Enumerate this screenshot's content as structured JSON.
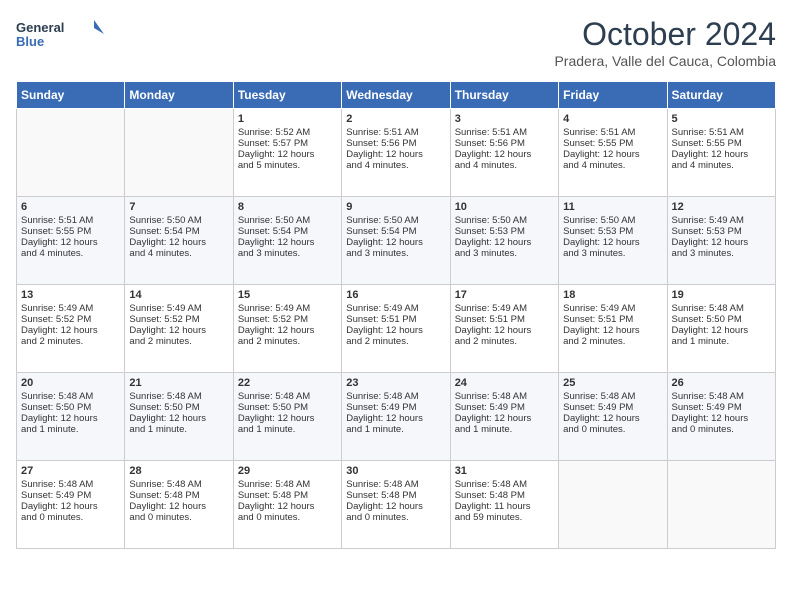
{
  "header": {
    "logo_line1": "General",
    "logo_line2": "Blue",
    "title": "October 2024",
    "subtitle": "Pradera, Valle del Cauca, Colombia"
  },
  "weekdays": [
    "Sunday",
    "Monday",
    "Tuesday",
    "Wednesday",
    "Thursday",
    "Friday",
    "Saturday"
  ],
  "weeks": [
    [
      {
        "day": "",
        "content": ""
      },
      {
        "day": "",
        "content": ""
      },
      {
        "day": "1",
        "content": "Sunrise: 5:52 AM\nSunset: 5:57 PM\nDaylight: 12 hours\nand 5 minutes."
      },
      {
        "day": "2",
        "content": "Sunrise: 5:51 AM\nSunset: 5:56 PM\nDaylight: 12 hours\nand 4 minutes."
      },
      {
        "day": "3",
        "content": "Sunrise: 5:51 AM\nSunset: 5:56 PM\nDaylight: 12 hours\nand 4 minutes."
      },
      {
        "day": "4",
        "content": "Sunrise: 5:51 AM\nSunset: 5:55 PM\nDaylight: 12 hours\nand 4 minutes."
      },
      {
        "day": "5",
        "content": "Sunrise: 5:51 AM\nSunset: 5:55 PM\nDaylight: 12 hours\nand 4 minutes."
      }
    ],
    [
      {
        "day": "6",
        "content": "Sunrise: 5:51 AM\nSunset: 5:55 PM\nDaylight: 12 hours\nand 4 minutes."
      },
      {
        "day": "7",
        "content": "Sunrise: 5:50 AM\nSunset: 5:54 PM\nDaylight: 12 hours\nand 4 minutes."
      },
      {
        "day": "8",
        "content": "Sunrise: 5:50 AM\nSunset: 5:54 PM\nDaylight: 12 hours\nand 3 minutes."
      },
      {
        "day": "9",
        "content": "Sunrise: 5:50 AM\nSunset: 5:54 PM\nDaylight: 12 hours\nand 3 minutes."
      },
      {
        "day": "10",
        "content": "Sunrise: 5:50 AM\nSunset: 5:53 PM\nDaylight: 12 hours\nand 3 minutes."
      },
      {
        "day": "11",
        "content": "Sunrise: 5:50 AM\nSunset: 5:53 PM\nDaylight: 12 hours\nand 3 minutes."
      },
      {
        "day": "12",
        "content": "Sunrise: 5:49 AM\nSunset: 5:53 PM\nDaylight: 12 hours\nand 3 minutes."
      }
    ],
    [
      {
        "day": "13",
        "content": "Sunrise: 5:49 AM\nSunset: 5:52 PM\nDaylight: 12 hours\nand 2 minutes."
      },
      {
        "day": "14",
        "content": "Sunrise: 5:49 AM\nSunset: 5:52 PM\nDaylight: 12 hours\nand 2 minutes."
      },
      {
        "day": "15",
        "content": "Sunrise: 5:49 AM\nSunset: 5:52 PM\nDaylight: 12 hours\nand 2 minutes."
      },
      {
        "day": "16",
        "content": "Sunrise: 5:49 AM\nSunset: 5:51 PM\nDaylight: 12 hours\nand 2 minutes."
      },
      {
        "day": "17",
        "content": "Sunrise: 5:49 AM\nSunset: 5:51 PM\nDaylight: 12 hours\nand 2 minutes."
      },
      {
        "day": "18",
        "content": "Sunrise: 5:49 AM\nSunset: 5:51 PM\nDaylight: 12 hours\nand 2 minutes."
      },
      {
        "day": "19",
        "content": "Sunrise: 5:48 AM\nSunset: 5:50 PM\nDaylight: 12 hours\nand 1 minute."
      }
    ],
    [
      {
        "day": "20",
        "content": "Sunrise: 5:48 AM\nSunset: 5:50 PM\nDaylight: 12 hours\nand 1 minute."
      },
      {
        "day": "21",
        "content": "Sunrise: 5:48 AM\nSunset: 5:50 PM\nDaylight: 12 hours\nand 1 minute."
      },
      {
        "day": "22",
        "content": "Sunrise: 5:48 AM\nSunset: 5:50 PM\nDaylight: 12 hours\nand 1 minute."
      },
      {
        "day": "23",
        "content": "Sunrise: 5:48 AM\nSunset: 5:49 PM\nDaylight: 12 hours\nand 1 minute."
      },
      {
        "day": "24",
        "content": "Sunrise: 5:48 AM\nSunset: 5:49 PM\nDaylight: 12 hours\nand 1 minute."
      },
      {
        "day": "25",
        "content": "Sunrise: 5:48 AM\nSunset: 5:49 PM\nDaylight: 12 hours\nand 0 minutes."
      },
      {
        "day": "26",
        "content": "Sunrise: 5:48 AM\nSunset: 5:49 PM\nDaylight: 12 hours\nand 0 minutes."
      }
    ],
    [
      {
        "day": "27",
        "content": "Sunrise: 5:48 AM\nSunset: 5:49 PM\nDaylight: 12 hours\nand 0 minutes."
      },
      {
        "day": "28",
        "content": "Sunrise: 5:48 AM\nSunset: 5:48 PM\nDaylight: 12 hours\nand 0 minutes."
      },
      {
        "day": "29",
        "content": "Sunrise: 5:48 AM\nSunset: 5:48 PM\nDaylight: 12 hours\nand 0 minutes."
      },
      {
        "day": "30",
        "content": "Sunrise: 5:48 AM\nSunset: 5:48 PM\nDaylight: 12 hours\nand 0 minutes."
      },
      {
        "day": "31",
        "content": "Sunrise: 5:48 AM\nSunset: 5:48 PM\nDaylight: 11 hours\nand 59 minutes."
      },
      {
        "day": "",
        "content": ""
      },
      {
        "day": "",
        "content": ""
      }
    ]
  ]
}
